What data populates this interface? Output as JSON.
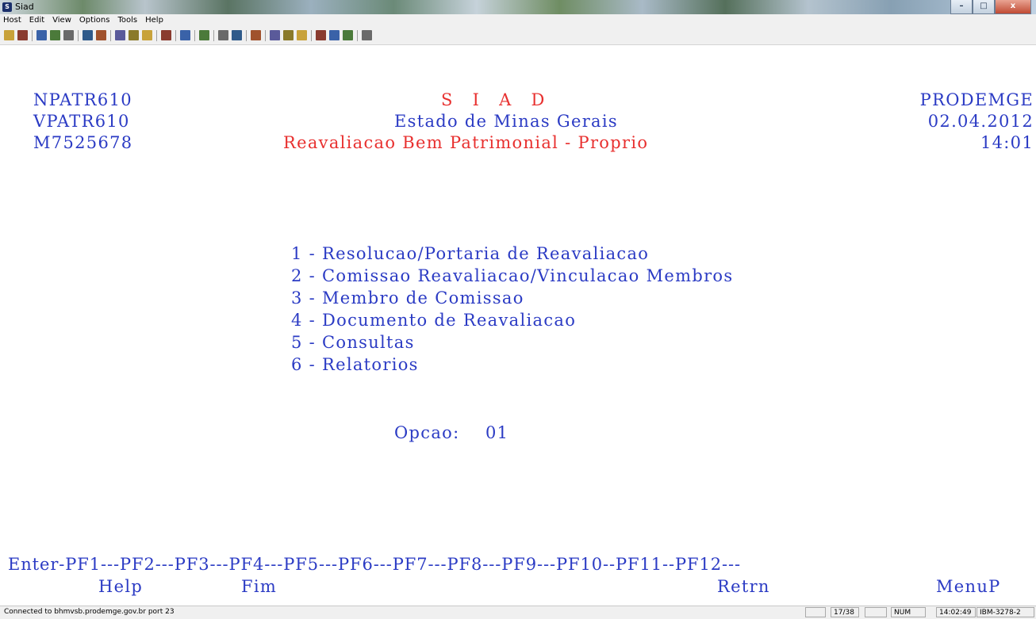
{
  "window": {
    "title": "Siad",
    "minimize": "–",
    "maximize": "□",
    "close": "x"
  },
  "menu": [
    "Host",
    "Edit",
    "View",
    "Options",
    "Tools",
    "Help"
  ],
  "toolbar_icons": [
    "connect-icon",
    "disconnect-icon",
    "sep",
    "send-icon",
    "receive-icon",
    "print-icon",
    "sep",
    "copy-screen-icon",
    "paste-screen-icon",
    "sep",
    "cut-icon",
    "copy-icon",
    "paste-icon",
    "sep",
    "more-icon",
    "sep",
    "chart-icon",
    "sep",
    "warning-icon",
    "sep",
    "black-box-icon",
    "pen-icon",
    "sep",
    "home-icon",
    "sep",
    "enter-icon",
    "backtab-icon",
    "tab-icon",
    "sep",
    "field1-icon",
    "field2-icon",
    "field3-icon",
    "sep",
    "undo-icon"
  ],
  "screen": {
    "program": "NPATR610",
    "view": "VPATR610",
    "user": "M7525678",
    "system": "S   I   A   D",
    "state": "Estado de Minas Gerais",
    "title": "Reavaliacao Bem Patrimonial - Proprio",
    "company": "PRODEMGE",
    "date": "02.04.2012",
    "time": "14:01",
    "menu_items": [
      "1 - Resolucao/Portaria de Reavaliacao",
      "2 - Comissao Reavaliacao/Vinculacao Membros",
      "3 - Membro de Comissao",
      "4 - Documento de Reavaliacao",
      "5 - Consultas",
      "6 - Relatorios"
    ],
    "option_label": "Opcao:",
    "option_value": "01",
    "pf_line": "Enter-PF1---PF2---PF3---PF4---PF5---PF6---PF7---PF8---PF9---PF10--PF11--PF12---",
    "pf_help": "Help",
    "pf_fim": "Fim",
    "pf_retrn": "Retrn",
    "pf_menup": "MenuP"
  },
  "status": {
    "connection": "Connected to bhmvsb.prodemge.gov.br port 23",
    "cursor": "17/38",
    "num": "NUM",
    "clock": "14:02:49",
    "terminal_type": "IBM-3278-2"
  }
}
